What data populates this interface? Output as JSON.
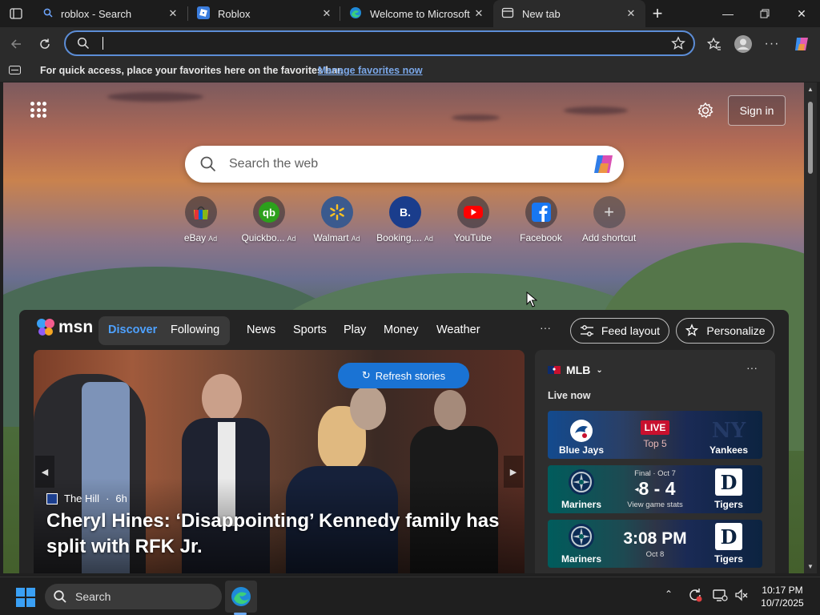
{
  "tabs": [
    {
      "title": "roblox - Search",
      "icon": "search-icon"
    },
    {
      "title": "Roblox",
      "icon": "roblox-icon"
    },
    {
      "title": "Welcome to Microsoft E",
      "icon": "edge-icon"
    },
    {
      "title": "New tab",
      "icon": "newtab-icon",
      "active": true
    }
  ],
  "toolbar": {
    "address_value": "",
    "icons": [
      "back-icon",
      "refresh-icon",
      "star-icon",
      "favorites-icon",
      "profile-icon",
      "more-icon",
      "copilot-icon"
    ]
  },
  "favbar": {
    "text": "For quick access, place your favorites here on the favorites bar.",
    "link": "Manage favorites now"
  },
  "ntp": {
    "signin": "Sign in",
    "search_placeholder": "Search the web",
    "shortcuts": [
      {
        "label": "eBay",
        "ad": "Ad",
        "icon": "ebay-icon"
      },
      {
        "label": "Quickbo...",
        "ad": "Ad",
        "icon": "quickbooks-icon"
      },
      {
        "label": "Walmart",
        "ad": "Ad",
        "icon": "walmart-icon"
      },
      {
        "label": "Booking....",
        "ad": "Ad",
        "icon": "booking-icon"
      },
      {
        "label": "YouTube",
        "ad": "",
        "icon": "youtube-icon"
      },
      {
        "label": "Facebook",
        "ad": "",
        "icon": "facebook-icon"
      },
      {
        "label": "Add shortcut",
        "ad": "",
        "icon": "plus-icon"
      }
    ]
  },
  "msn": {
    "logo": "msn",
    "nav": [
      "Discover",
      "Following",
      "News",
      "Sports",
      "Play",
      "Money",
      "Weather"
    ],
    "more": "···",
    "feed_layout": "Feed layout",
    "personalize": "Personalize",
    "hero": {
      "refresh": "Refresh stories",
      "source": "The Hill",
      "age": "6h",
      "title": "Cheryl Hines: ‘Disappointing’ Kennedy family has split with RFK Jr."
    },
    "mlb": {
      "league": "MLB",
      "more": "···",
      "live_now": "Live now",
      "games": [
        {
          "left": "Blue Jays",
          "right": "Yankees",
          "status": "LIVE",
          "detail": "Top 5",
          "left_color": "#134a8e",
          "right_color": "#0c2340"
        },
        {
          "left": "Mariners",
          "right": "Tigers",
          "top": "Final · Oct 7",
          "score": "8 - 4",
          "detail": "View game stats",
          "left_color": "#005c5c",
          "right_color": "#0c2340"
        },
        {
          "left": "Mariners",
          "right": "Tigers",
          "time": "3:08 PM",
          "date": "Oct 8",
          "left_color": "#005c5c",
          "right_color": "#0c2340"
        }
      ]
    }
  },
  "taskbar": {
    "search": "Search",
    "time": "10:17 PM",
    "date": "10/7/2025"
  }
}
